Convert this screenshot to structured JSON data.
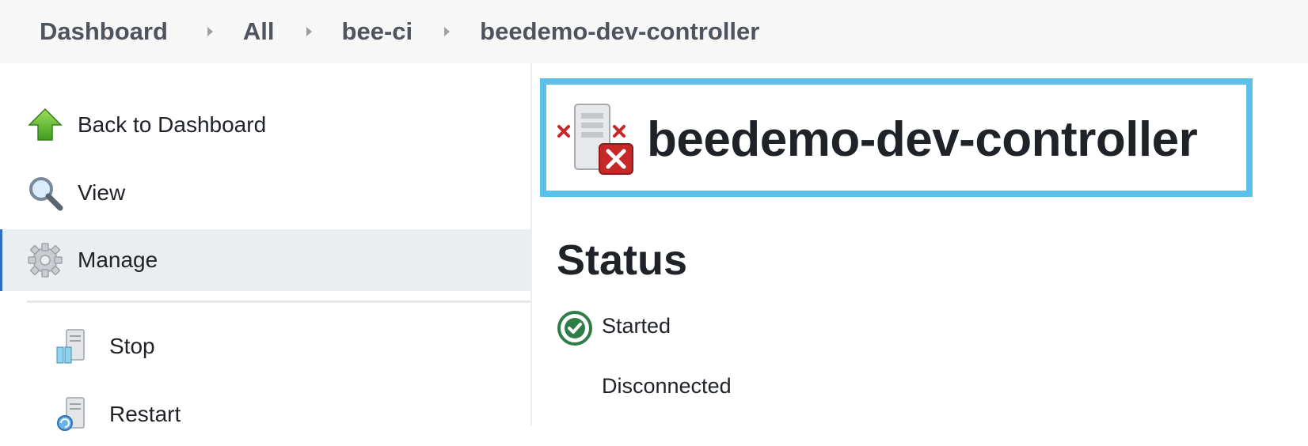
{
  "breadcrumb": {
    "items": [
      "Dashboard",
      "All",
      "bee-ci",
      "beedemo-dev-controller"
    ]
  },
  "sidebar": {
    "items": [
      {
        "label": "Back to Dashboard",
        "icon": "up-arrow-icon"
      },
      {
        "label": "View",
        "icon": "magnifier-icon"
      },
      {
        "label": "Manage",
        "icon": "gear-icon",
        "active": true
      },
      {
        "label": "Stop",
        "icon": "server-stop-icon"
      },
      {
        "label": "Restart",
        "icon": "server-restart-icon"
      }
    ]
  },
  "main": {
    "title": "beedemo-dev-controller",
    "title_icon": "server-disconnected-icon",
    "section_heading": "Status",
    "status": {
      "started": "Started",
      "connection": "Disconnected"
    }
  },
  "colors": {
    "highlight_border": "#5bc0eb",
    "active_bar": "#2f6fbf",
    "started_green": "#2e7d46",
    "error_red": "#c62828"
  }
}
